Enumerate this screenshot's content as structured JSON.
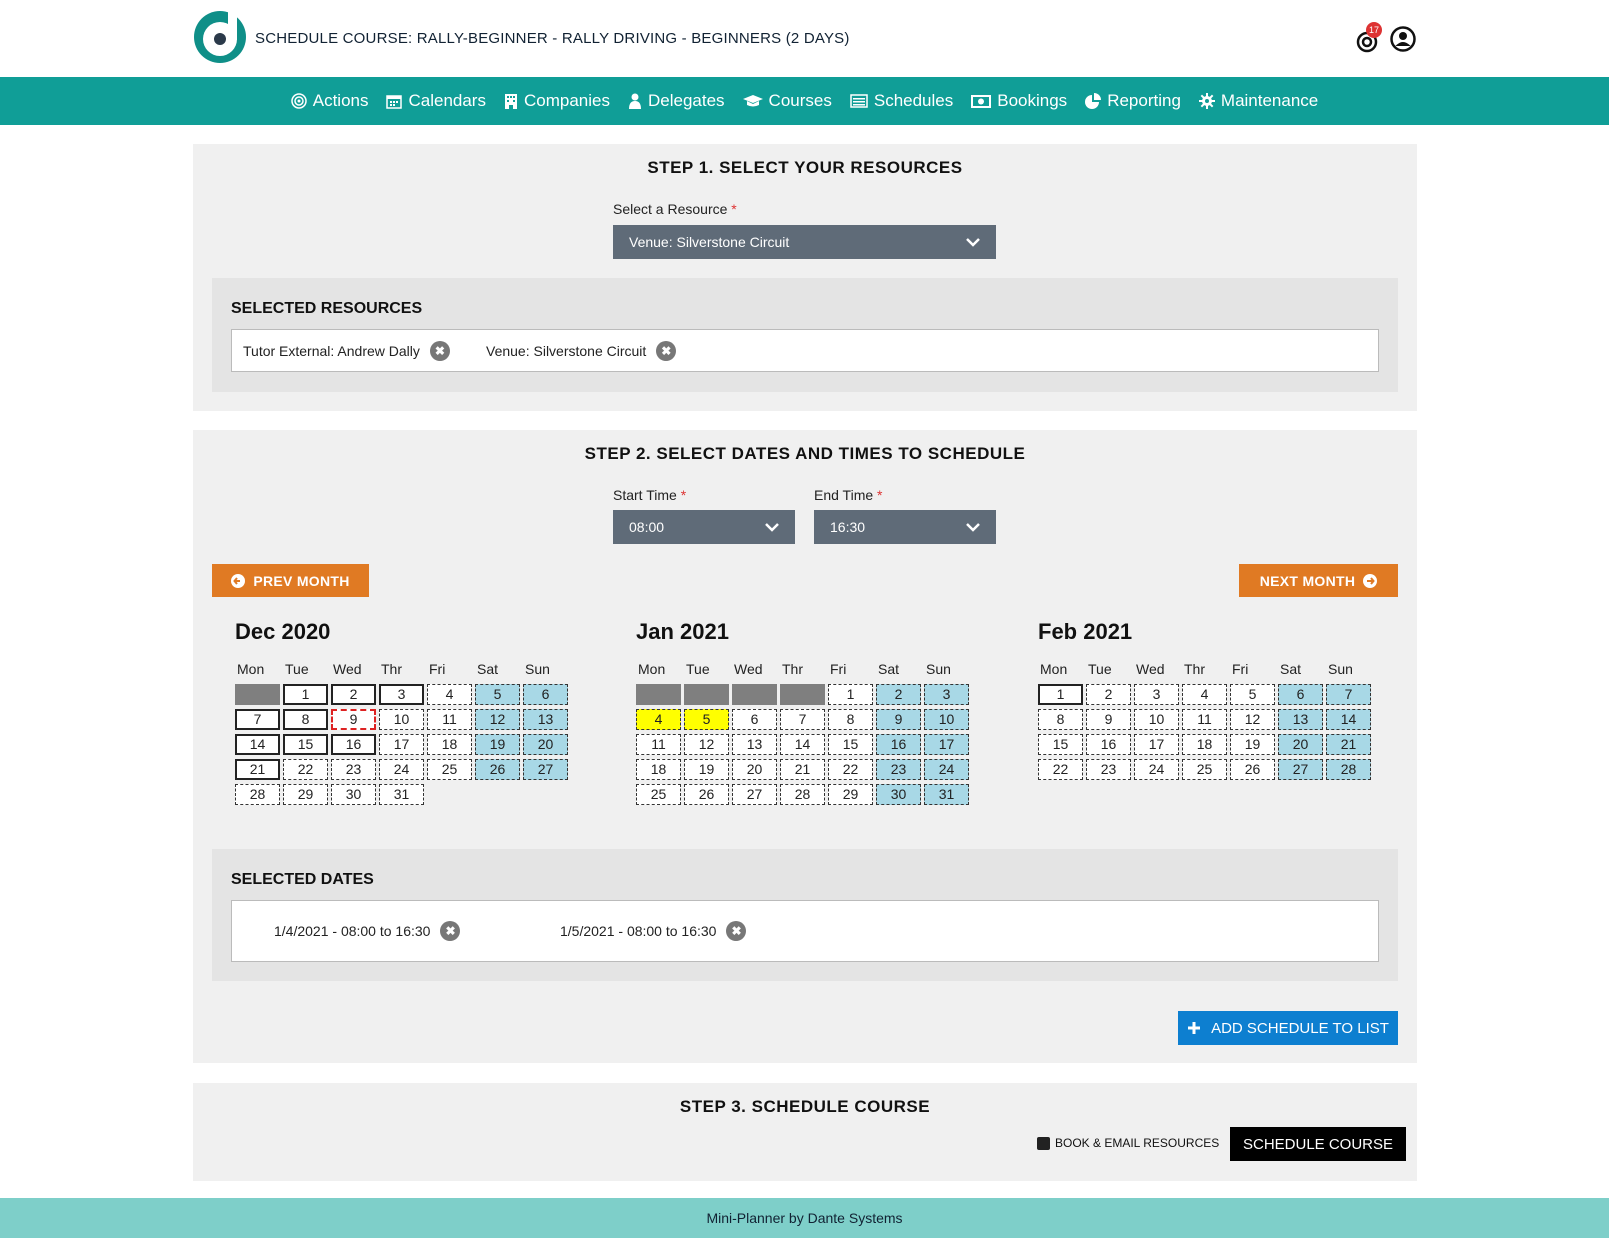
{
  "header": {
    "title": "SCHEDULE COURSE: RALLY-BEGINNER - RALLY DRIVING - BEGINNERS (2 DAYS)",
    "notification_count": "17"
  },
  "nav": {
    "items": [
      {
        "label": "Actions",
        "icon": "target-icon"
      },
      {
        "label": "Calendars",
        "icon": "calendar-icon"
      },
      {
        "label": "Companies",
        "icon": "building-icon"
      },
      {
        "label": "Delegates",
        "icon": "person-icon"
      },
      {
        "label": "Courses",
        "icon": "graduation-cap-icon"
      },
      {
        "label": "Schedules",
        "icon": "list-icon"
      },
      {
        "label": "Bookings",
        "icon": "money-icon"
      },
      {
        "label": "Reporting",
        "icon": "pie-chart-icon"
      },
      {
        "label": "Maintenance",
        "icon": "gear-icon"
      }
    ]
  },
  "step1": {
    "title": "STEP 1. SELECT YOUR RESOURCES",
    "resource_label": "Select a Resource",
    "required_mark": "*",
    "resource_value": "Venue: Silverstone Circuit",
    "selected_title": "SELECTED RESOURCES",
    "selected": [
      "Tutor External: Andrew Dally",
      "Venue: Silverstone Circuit"
    ]
  },
  "step2": {
    "title": "STEP 2. SELECT DATES AND TIMES TO SCHEDULE",
    "start_label": "Start Time",
    "start_value": "08:00",
    "end_label": "End Time",
    "end_value": "16:30",
    "prev_label": "PREV MONTH",
    "next_label": "NEXT MONTH",
    "dow": [
      "Mon",
      "Tue",
      "Wed",
      "Thr",
      "Fri",
      "Sat",
      "Sun"
    ],
    "months": [
      {
        "title": "Dec 2020",
        "offset": 1,
        "days": 31,
        "solid": [
          1,
          2,
          3,
          7,
          8,
          14,
          15,
          16,
          21
        ],
        "today": 9,
        "selected": []
      },
      {
        "title": "Jan 2021",
        "offset": 4,
        "days": 31,
        "solid": [],
        "today": null,
        "selected": [
          4,
          5
        ]
      },
      {
        "title": "Feb 2021",
        "offset": 0,
        "days": 28,
        "solid": [
          1
        ],
        "today": null,
        "selected": []
      }
    ],
    "selected_title": "SELECTED DATES",
    "selected_dates": [
      "1/4/2021 - 08:00 to 16:30",
      "1/5/2021 - 08:00 to 16:30"
    ],
    "add_label": "ADD SCHEDULE TO LIST"
  },
  "step3": {
    "title": "STEP 3. SCHEDULE COURSE",
    "checkbox_label": "BOOK & EMAIL RESOURCES",
    "schedule_label": "SCHEDULE COURSE"
  },
  "footer": {
    "text": "Mini-Planner by Dante Systems"
  },
  "colors": {
    "teal": "#109e97",
    "orange": "#e07a23",
    "blue": "#0d7fd0",
    "weekend": "#a8d8e6",
    "selected": "#ffff00"
  }
}
